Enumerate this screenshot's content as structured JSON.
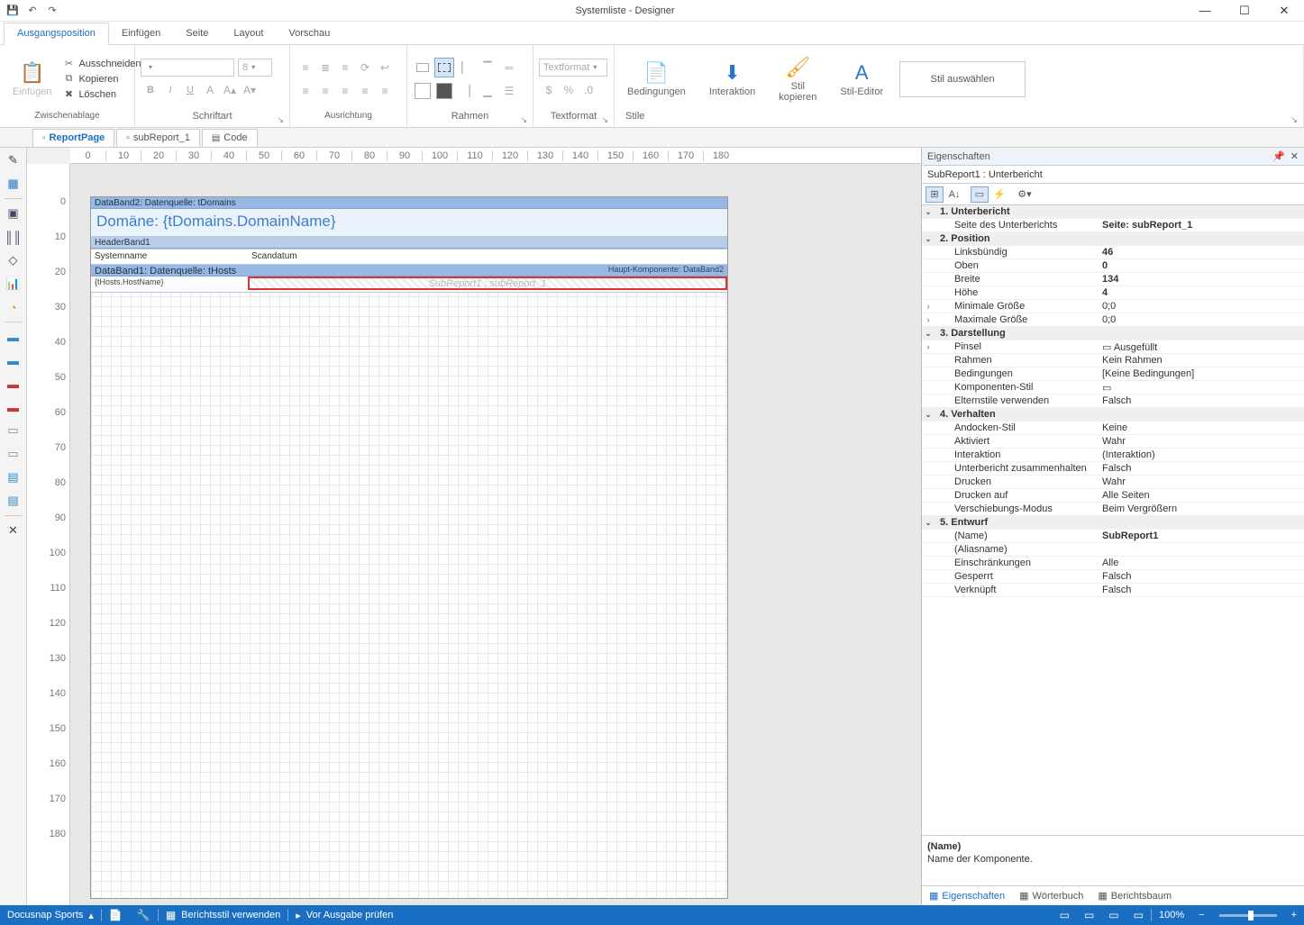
{
  "window": {
    "title": "Systemliste - Designer"
  },
  "qat": {
    "save": "💾",
    "undo": "↶",
    "redo": "↷"
  },
  "ribbon_tabs": [
    "Ausgangsposition",
    "Einfügen",
    "Seite",
    "Layout",
    "Vorschau"
  ],
  "ribbon": {
    "paste": "Einfügen",
    "cut": "Ausschneiden",
    "copy": "Kopieren",
    "delete": "Löschen",
    "g_clipboard": "Zwischenablage",
    "fontsize": "8",
    "g_font": "Schriftart",
    "g_align": "Ausrichtung",
    "g_border": "Rahmen",
    "textformat": "Textformat",
    "g_textformat": "Textformat",
    "conditions": "Bedingungen",
    "interaction": "Interaktion",
    "stylecopy": "Stil\nkopieren",
    "styleeditor": "Stil-Editor",
    "styleselect": "Stil auswählen",
    "g_style": "Stile"
  },
  "doc_tabs": [
    {
      "label": "ReportPage",
      "active": true
    },
    {
      "label": "subReport_1",
      "active": false
    },
    {
      "label": "Code",
      "active": false
    }
  ],
  "hruler": [
    "0",
    "10",
    "20",
    "30",
    "40",
    "50",
    "60",
    "70",
    "80",
    "90",
    "100",
    "110",
    "120",
    "130",
    "140",
    "150",
    "160",
    "170",
    "180"
  ],
  "vruler": [
    "0",
    "10",
    "20",
    "30",
    "40",
    "50",
    "60",
    "70",
    "80",
    "90",
    "100",
    "110",
    "120",
    "130",
    "140",
    "150",
    "160",
    "170",
    "180"
  ],
  "design": {
    "band2": "DataBand2: Datenquelle: tDomains",
    "domain": "Domäne: {tDomains.DomainName}",
    "header": "HeaderBand1",
    "col1": "Systemname",
    "col2": "Scandatum",
    "band1": "DataBand1: Datenquelle: tHosts",
    "hk": "Haupt-Komponente: DataBand2",
    "host": "{tHosts.HostName}",
    "sub": "SubReport1 ; subReport_1"
  },
  "props": {
    "title": "Eigenschaften",
    "object": "SubReport1 : Unterbericht",
    "rows": [
      {
        "t": "cat",
        "k": "1. Unterbericht"
      },
      {
        "t": "p",
        "k": "Seite des Unterberichts",
        "v": "Seite: subReport_1",
        "bold": true
      },
      {
        "t": "cat",
        "k": "2. Position"
      },
      {
        "t": "p",
        "k": "Linksbündig",
        "v": "46",
        "bold": true
      },
      {
        "t": "p",
        "k": "Oben",
        "v": "0",
        "bold": true
      },
      {
        "t": "p",
        "k": "Breite",
        "v": "134",
        "bold": true
      },
      {
        "t": "p",
        "k": "Höhe",
        "v": "4",
        "bold": true
      },
      {
        "t": "pe",
        "k": "Minimale Größe",
        "v": "0;0"
      },
      {
        "t": "pe",
        "k": "Maximale Größe",
        "v": "0;0"
      },
      {
        "t": "cat",
        "k": "3. Darstellung"
      },
      {
        "t": "pe",
        "k": "Pinsel",
        "v": "▭ Ausgefüllt"
      },
      {
        "t": "p",
        "k": "Rahmen",
        "v": "Kein Rahmen"
      },
      {
        "t": "p",
        "k": "Bedingungen",
        "v": "[Keine Bedingungen]"
      },
      {
        "t": "p",
        "k": "Komponenten-Stil",
        "v": "▭"
      },
      {
        "t": "p",
        "k": "Elternstile verwenden",
        "v": "Falsch"
      },
      {
        "t": "cat",
        "k": "4. Verhalten"
      },
      {
        "t": "p",
        "k": "Andocken-Stil",
        "v": "Keine"
      },
      {
        "t": "p",
        "k": "Aktiviert",
        "v": "Wahr"
      },
      {
        "t": "p",
        "k": "Interaktion",
        "v": "(Interaktion)"
      },
      {
        "t": "p",
        "k": "Unterbericht zusammenhalten",
        "v": "Falsch"
      },
      {
        "t": "p",
        "k": "Drucken",
        "v": "Wahr"
      },
      {
        "t": "p",
        "k": "Drucken auf",
        "v": "Alle Seiten"
      },
      {
        "t": "p",
        "k": "Verschiebungs-Modus",
        "v": "Beim Vergrößern"
      },
      {
        "t": "cat",
        "k": "5. Entwurf"
      },
      {
        "t": "p",
        "k": "(Name)",
        "v": "SubReport1",
        "bold": true
      },
      {
        "t": "p",
        "k": "(Aliasname)",
        "v": ""
      },
      {
        "t": "p",
        "k": "Einschränkungen",
        "v": "Alle"
      },
      {
        "t": "p",
        "k": "Gesperrt",
        "v": "Falsch"
      },
      {
        "t": "p",
        "k": "Verknüpft",
        "v": "Falsch"
      }
    ],
    "desc_title": "(Name)",
    "desc_text": "Name der Komponente.",
    "foot": [
      "Eigenschaften",
      "Wörterbuch",
      "Berichtsbaum"
    ]
  },
  "status": {
    "app": "Docusnap Sports",
    "style": "Berichtsstil verwenden",
    "check": "Vor Ausgabe prüfen",
    "zoom": "100%"
  }
}
